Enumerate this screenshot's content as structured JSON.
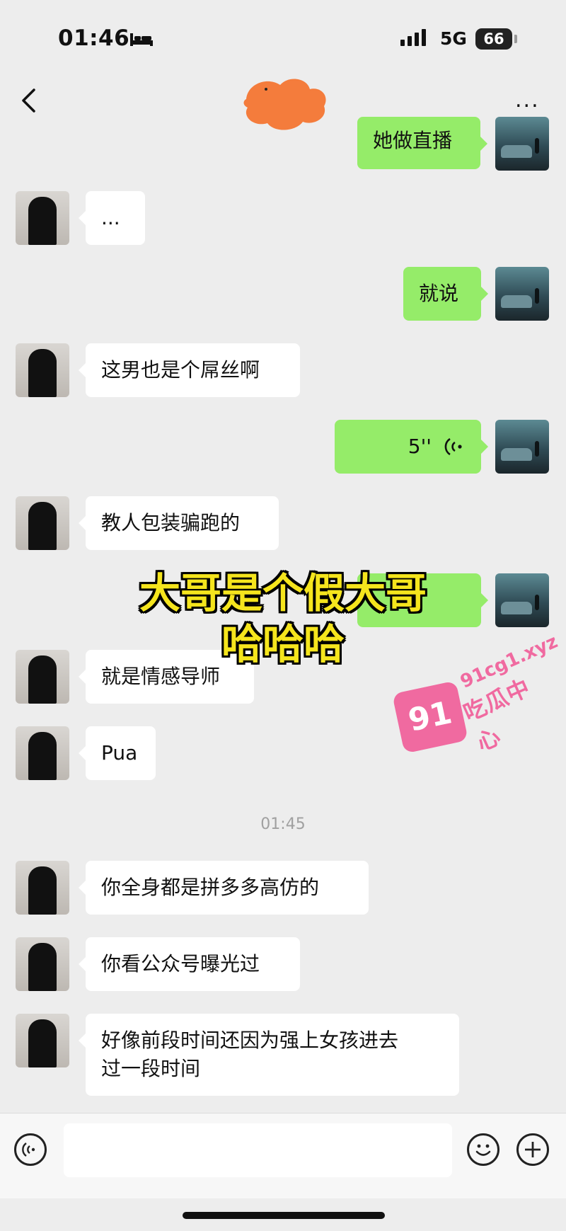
{
  "status_bar": {
    "time": "01:46",
    "network": "5G",
    "battery": "66"
  },
  "nav": {
    "more_label": "..."
  },
  "messages": [
    {
      "side": "right",
      "text": "她做直播"
    },
    {
      "side": "left",
      "text": "..."
    },
    {
      "side": "right",
      "text": "就说"
    },
    {
      "side": "left",
      "text": "这男也是个屌丝啊"
    },
    {
      "side": "right",
      "type": "voice",
      "duration": "5''"
    },
    {
      "side": "left",
      "text": "教人包装骗跑的"
    },
    {
      "side": "left",
      "text": "就是情感导师"
    },
    {
      "side": "left",
      "text": "Pua"
    },
    {
      "side": "left",
      "text": "你全身都是拼多多高仿的"
    },
    {
      "side": "left",
      "text": "你看公众号曝光过"
    },
    {
      "side": "left",
      "text": "好像前段时间还因为强上女孩进去",
      "text2": "过一段时间"
    }
  ],
  "timestamp": "01:45",
  "overlay": {
    "line1": "大哥是个假大哥",
    "line2": "哈哈哈"
  },
  "watermark": {
    "badge": "91",
    "site": "91cg1.xyz",
    "name": "吃瓜中心"
  },
  "colors": {
    "outgoing_bubble": "#95ec69",
    "incoming_bubble": "#ffffff",
    "background": "#ededed",
    "overlay_text": "#f5e51d",
    "watermark": "#f06aa0"
  },
  "icons": [
    "bed-icon",
    "signal-icon",
    "battery-icon",
    "back-icon",
    "more-icon",
    "voice-wave-icon",
    "voice-input-icon",
    "emoji-icon",
    "plus-icon"
  ]
}
